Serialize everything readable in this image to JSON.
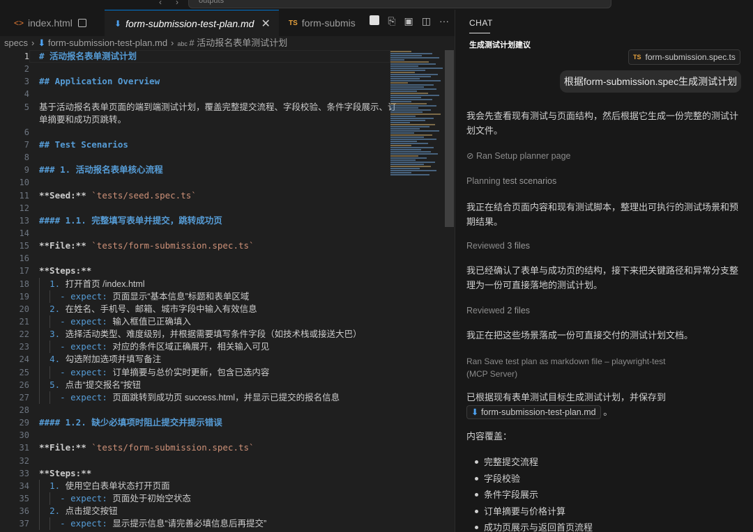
{
  "topbar": {
    "search_text": "outputs"
  },
  "tabs": [
    {
      "label": "index.html"
    },
    {
      "label": "form-submission-test-plan.md"
    },
    {
      "label": "form-submis"
    }
  ],
  "breadcrumb": {
    "root": "specs",
    "file": "form-submission-test-plan.md",
    "symbol": "# 活动报名表单测试计划"
  },
  "editor": {
    "line_numbers": [
      "1",
      "2",
      "3",
      "4",
      "5",
      "",
      "6",
      "7",
      "8",
      "9",
      "10",
      "11",
      "12",
      "13",
      "14",
      "15",
      "16",
      "17",
      "18",
      "19",
      "20",
      "21",
      "22",
      "23",
      "24",
      "25",
      "26",
      "27",
      "28",
      "29",
      "30",
      "31",
      "32",
      "33",
      "34",
      "35",
      "36",
      "37"
    ],
    "lines": {
      "l1": "# 活动报名表单测试计划",
      "l3": "## Application Overview",
      "l5a": "基于活动报名表单页面的端到端测试计划，覆盖完整提交流程、字段校验、条件字段展示、订",
      "l5b": "单摘要和成功页跳转。",
      "l7": "## Test Scenarios",
      "l9": "### 1. 活动报名表单核心流程",
      "l11_key": "**Seed:**",
      "l11_val": "`tests/seed.spec.ts`",
      "l13": "#### 1.1. 完整填写表单并提交，跳转成功页",
      "l15_key": "**File:**",
      "l15_val": "`tests/form-submission.spec.ts`",
      "l17": "**Steps:**",
      "l18_n": "1.",
      "l18": "打开首页 /index.html",
      "l19_d": "- expect:",
      "l19": "页面显示“基本信息”标题和表单区域",
      "l20_n": "2.",
      "l20": "在姓名、手机号、邮箱、城市字段中输入有效信息",
      "l21_d": "- expect:",
      "l21": "输入框值已正确填入",
      "l22_n": "3.",
      "l22": "选择活动类型、难度级别，并根据需要填写条件字段（如技术栈或接送大巴）",
      "l23_d": "- expect:",
      "l23": "对应的条件区域正确展开，相关输入可见",
      "l24_n": "4.",
      "l24": "勾选附加选项并填写备注",
      "l25_d": "- expect:",
      "l25": "订单摘要与总价实时更新，包含已选内容",
      "l26_n": "5.",
      "l26": "点击“提交报名”按钮",
      "l27_d": "- expect:",
      "l27": "页面跳转到成功页 success.html，并显示已提交的报名信息",
      "l29": "#### 1.2. 缺少必填项时阻止提交并提示错误",
      "l31_key": "**File:**",
      "l31_val": "`tests/form-submission.spec.ts`",
      "l33": "**Steps:**",
      "l34_n": "1.",
      "l34": "使用空白表单状态打开页面",
      "l35_d": "- expect:",
      "l35": "页面处于初始空状态",
      "l36_n": "2.",
      "l36": "点击提交按钮",
      "l37_d": "- expect:",
      "l37": "显示提示信息“请完善必填信息后再提交”"
    }
  },
  "chat": {
    "header": "CHAT",
    "title": "生成测试计划建议",
    "attached_file": "form-submission.spec.ts",
    "user_message": "根据form-submission.spec生成测试计划",
    "msg1": "我会先查看现有测试与页面结构，然后根据它生成一份完整的测试计划文件。",
    "status1": "Ran Setup planner page",
    "status2_a": "Planning",
    "status2_b": "test scenarios",
    "msg2": "我正在结合页面内容和现有测试脚本，整理出可执行的测试场景和预期结果。",
    "status3_a": "Reviewed",
    "status3_b": "3 files",
    "msg3": "我已经确认了表单与成功页的结构，接下来把关键路径和异常分支整理为一份可直接落地的测试计划。",
    "status4_a": "Reviewed",
    "status4_b": "2 files",
    "msg4": "我正在把这些场景落成一份可直接交付的测试计划文档。",
    "tool_text": "Ran Save test plan as markdown file – playwright-test (MCP Server)",
    "msg5": "已根据现有表单测试目标生成测试计划，并保存到",
    "msg5_file": "form-submission-test-plan.md",
    "msg5_end": "。",
    "coverage_label": "内容覆盖：",
    "coverage": [
      "完整提交流程",
      "字段校验",
      "条件字段展示",
      "订单摘要与价格计算",
      "成功页展示与返回首页流程"
    ]
  }
}
